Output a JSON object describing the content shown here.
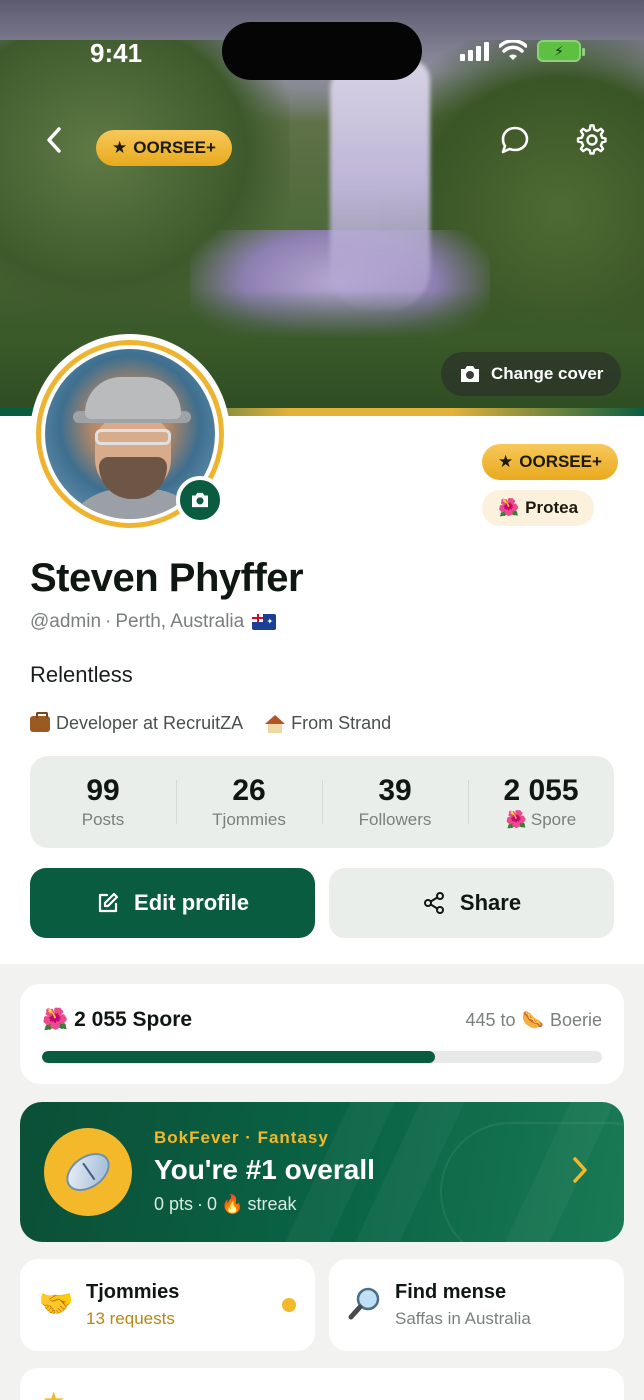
{
  "status_bar": {
    "time": "9:41"
  },
  "cover": {
    "tier_badge": "OORSEE+",
    "change_cover_label": "Change cover"
  },
  "profile": {
    "name": "Steven Phyffer",
    "handle": "@admin",
    "separator": "·",
    "location": "Perth, Australia",
    "bio": "Relentless",
    "work": "Developer at RecruitZA",
    "hometown": "From Strand",
    "badges": {
      "tier": "OORSEE+",
      "protea": "Protea"
    }
  },
  "stats": [
    {
      "value": "99",
      "label": "Posts"
    },
    {
      "value": "26",
      "label": "Tjommies"
    },
    {
      "value": "39",
      "label": "Followers"
    },
    {
      "value": "2 055",
      "label": "Spore"
    }
  ],
  "actions": {
    "edit_label": "Edit profile",
    "share_label": "Share"
  },
  "spore_progress": {
    "title": "2 055 Spore",
    "remaining": "445 to",
    "next_level": "Boerie",
    "progress_fraction": 0.702
  },
  "fantasy": {
    "kicker": "BokFever · Fantasy",
    "title": "You're #1 overall",
    "points": "0 pts",
    "separator": "·",
    "streak_count": "0",
    "streak_label": "streak"
  },
  "tiles": {
    "tjommies": {
      "title": "Tjommies",
      "subtitle": "13 requests"
    },
    "find": {
      "title": "Find mense",
      "subtitle": "Saffas in Australia"
    }
  },
  "colors": {
    "brand_green": "#0a5c40",
    "accent_gold": "#f3b92a"
  },
  "icons": {
    "back": "chevron-left-icon",
    "chat": "chat-bubble-icon",
    "settings": "gear-icon",
    "camera": "camera-icon",
    "edit": "edit-icon",
    "share": "share-icon",
    "protea": "protea-flower-icon",
    "fire": "fire-icon",
    "handshake": "handshake-icon",
    "magnifier": "magnifier-icon"
  }
}
